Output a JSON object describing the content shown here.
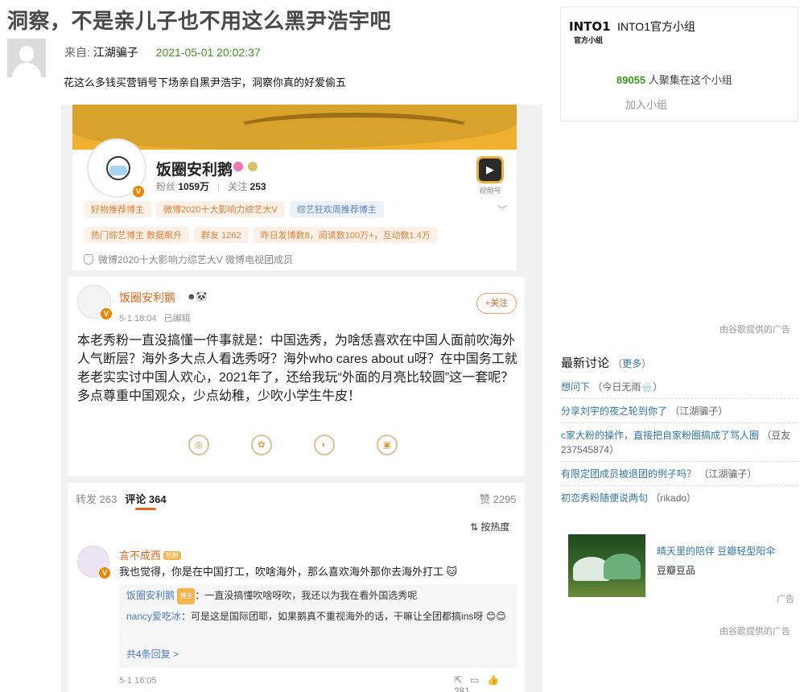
{
  "post": {
    "title": "洞察，不是亲儿子也不用这么黑尹浩宇吧",
    "from_label": "来自:",
    "author": "江湖骗子",
    "time": "2021-05-01 20:02:37",
    "body": "花这么多钱买营销号下场亲自黑尹浩宇，洞察你真的好爱偷五"
  },
  "screenshot": {
    "profile": {
      "name": "饭圈安利鹅",
      "fans_label": "粉丝",
      "fans": "1059万",
      "follow_label": "关注",
      "follow": "253",
      "video_label": "视频号",
      "tags_row1": [
        "好物推荐博主",
        "微博2020十大影响力综艺大V",
        "综艺狂欢周推荐博主"
      ],
      "tags_row2": [
        "热门综艺博主 数据飙升",
        "群友 1262",
        "昨日发博数8，阅读数100万+，互动数1.4万"
      ],
      "verify": "微博2020十大影响力综艺大V 微博电视团成员"
    },
    "weibo": {
      "name": "饭圈安利鹅",
      "time": "5-1 18:04",
      "edited": "已编辑",
      "follow_btn": "+关注",
      "text": "本老秀粉一直没搞懂一件事就是：中国选秀，为啥恁喜欢在中国人面前吹海外人气断层？海外多大点人看选秀呀？海外who cares about u呀？在中国务工就老老实实讨中国人欢心，2021年了，还给我玩“外面的月亮比较圆”这一套呢？多点尊重中国观众，少点幼稚，少吹小学生牛皮！"
    },
    "comments": {
      "repost_label": "转发 263",
      "comment_label": "评论 364",
      "like_label": "赞 2295",
      "sort_label": "按热度",
      "top": {
        "name": "言不成西",
        "text": "我也觉得，你是在中国打工，吹啥海外，那么喜欢海外那你去海外打工 🐱",
        "time": "5-1 18:05",
        "likes": "281"
      },
      "replies": [
        {
          "name": "饭圈安利鹅",
          "tag": "博主",
          "text": "：一直没搞懂吹啥呀吹，我还以为我在看外国选秀呢"
        },
        {
          "name": "nancy爱吃冰",
          "tag": "",
          "text": "：可是这是国际团耶，如果鹅真不重视海外的话，干嘛让全团都搞ins呀 😊😊"
        }
      ],
      "more_replies": "共4条回复 >"
    }
  },
  "group": {
    "logo_line1": "INTO1",
    "logo_line2": "官方小组",
    "name": "INTO1官方小组",
    "count": "89055",
    "count_suffix": " 人聚集在这个小组",
    "join": "加入小组"
  },
  "ads": {
    "provided_by_1": "由谷歌提供的广告",
    "provided_by_2": "由谷歌提供的广告",
    "ad_label": "广告",
    "title": "晴天里的陪伴 豆瓣轻型阳伞",
    "brand": "豆瓣豆品"
  },
  "discussions": {
    "title": "最新讨论",
    "more_open": "（",
    "more_link": "更多",
    "more_close": "）",
    "items": [
      {
        "link": "想问下",
        "author": "（今日无雨🌧️）"
      },
      {
        "link": "分享刘宇的夜之轮到你了",
        "author": "（江湖骗子）"
      },
      {
        "link": "c家大粉的操作，直接把自家粉圈搞成了骂人圈",
        "author": "（豆友237545874）"
      },
      {
        "link": "有限定团成员被退团的例子吗？",
        "author": "（江湖骗子）"
      },
      {
        "link": "初恋秀粉随便说两句",
        "author": "（rikado）"
      }
    ]
  }
}
